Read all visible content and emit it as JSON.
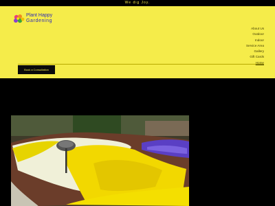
{
  "announcement": "We dig Joy.",
  "brand": {
    "line1": "Plant Happy",
    "line2": "Gardening"
  },
  "nav": [
    {
      "label": "About Us"
    },
    {
      "label": "Outdoor"
    },
    {
      "label": "Indoor"
    },
    {
      "label": "Service Area"
    },
    {
      "label": "Gallery"
    },
    {
      "label": "Gift Cards"
    },
    {
      "label": "Home",
      "active": true
    }
  ],
  "cta": {
    "label": "Book a Consultation"
  },
  "hero_image": {
    "subject": "garden flower bed with yellow, white and purple pansies and a garden light"
  },
  "colors": {
    "brand_yellow": "#f5ec4a",
    "background": "#000000",
    "logo_blue": "#2d2bb8"
  }
}
